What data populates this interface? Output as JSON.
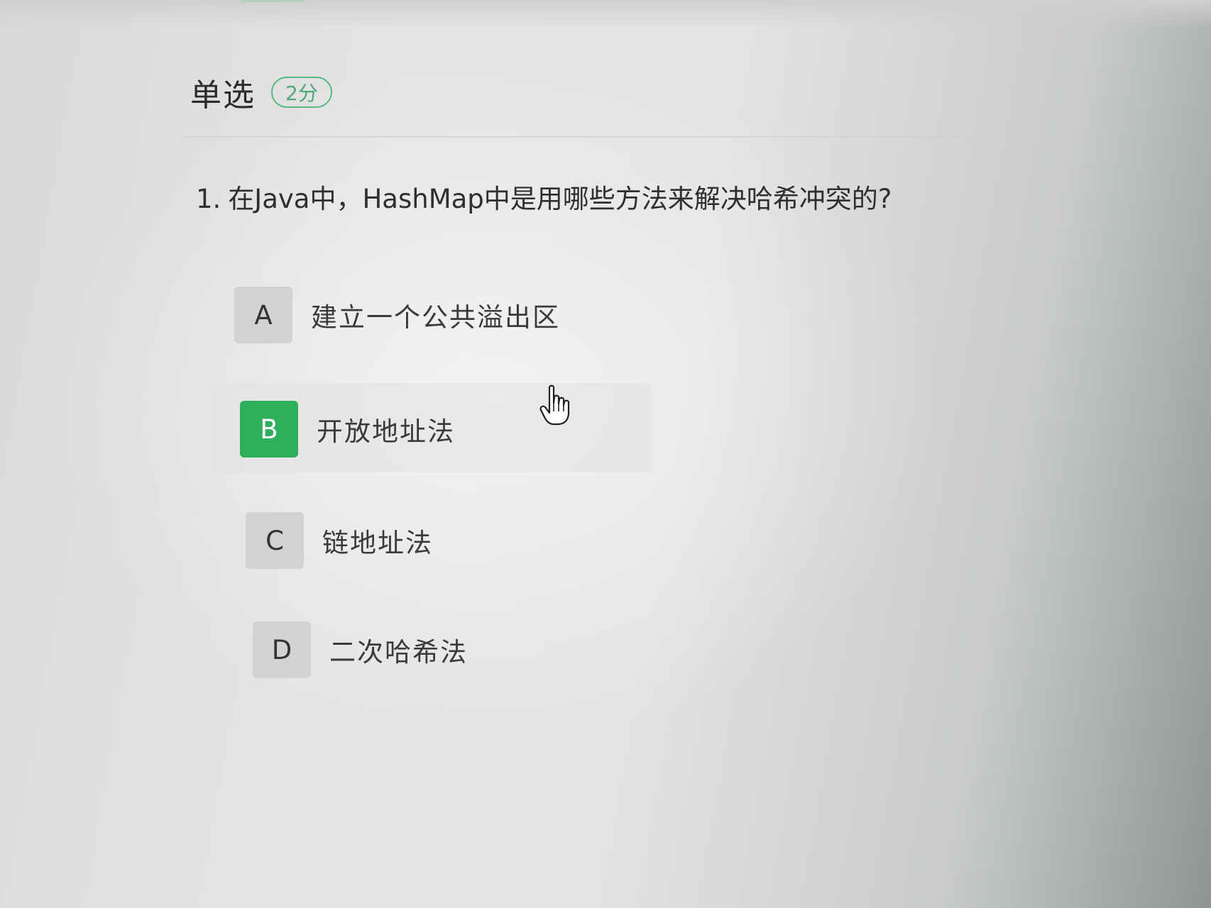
{
  "section": {
    "title": "单选",
    "score_badge": "2分"
  },
  "question": {
    "number": "1.",
    "text": "在Java中，HashMap中是用哪些方法来解决哈希冲突的?"
  },
  "options": [
    {
      "letter": "A",
      "text": "建立一个公共溢出区",
      "selected": false
    },
    {
      "letter": "B",
      "text": "开放地址法",
      "selected": true
    },
    {
      "letter": "C",
      "text": "链地址法",
      "selected": false
    },
    {
      "letter": "D",
      "text": "二次哈希法",
      "selected": false
    }
  ],
  "colors": {
    "accent_green": "#2fae5b",
    "badge_green": "#58b883"
  },
  "cursor_icon": "hand-pointer-icon"
}
